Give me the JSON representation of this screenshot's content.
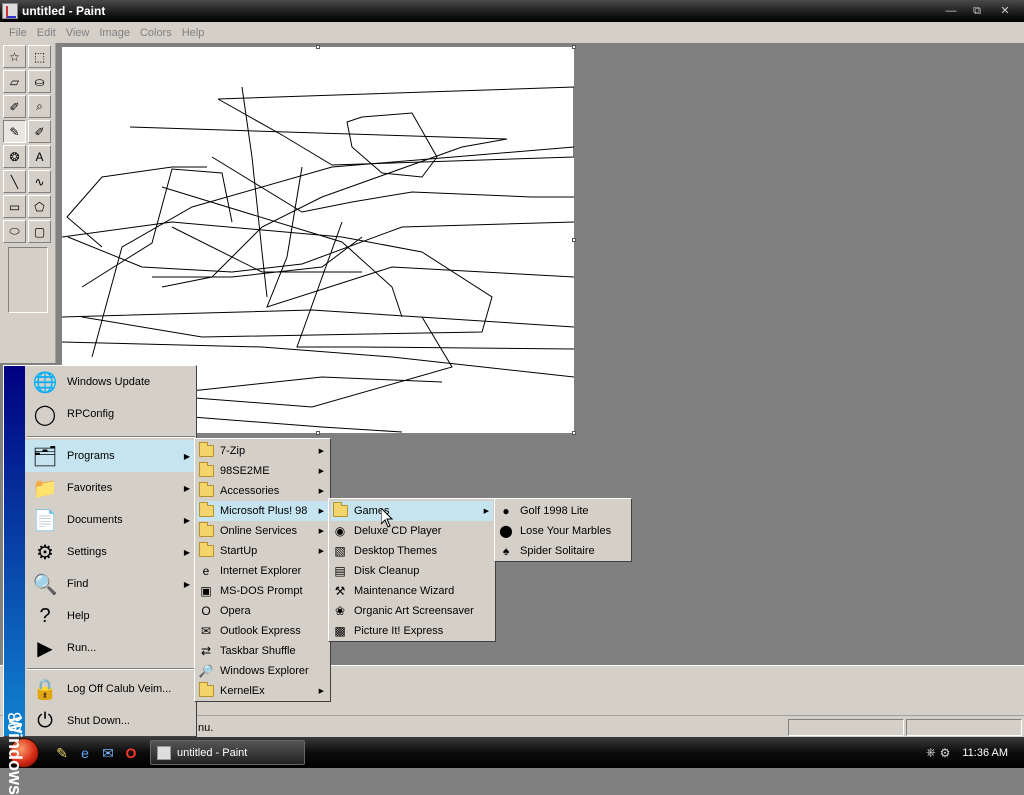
{
  "window": {
    "title": "untitled - Paint",
    "controls": {
      "minimize": "—",
      "maximize": "⧉",
      "close": "✕"
    }
  },
  "menubar": {
    "items": [
      "File",
      "Edit",
      "View",
      "Image",
      "Colors",
      "Help"
    ]
  },
  "toolbox": {
    "tools": [
      {
        "name": "free-form-select-icon",
        "glyph": "☆"
      },
      {
        "name": "rect-select-icon",
        "glyph": "⬚"
      },
      {
        "name": "eraser-icon",
        "glyph": "▱"
      },
      {
        "name": "fill-icon",
        "glyph": "⛀"
      },
      {
        "name": "pick-color-icon",
        "glyph": "✐"
      },
      {
        "name": "magnifier-icon",
        "glyph": "⌕"
      },
      {
        "name": "pencil-icon",
        "glyph": "✎",
        "pressed": true
      },
      {
        "name": "brush-icon",
        "glyph": "✐"
      },
      {
        "name": "airbrush-icon",
        "glyph": "❂"
      },
      {
        "name": "text-icon",
        "glyph": "A"
      },
      {
        "name": "line-icon",
        "glyph": "╲"
      },
      {
        "name": "curve-icon",
        "glyph": "∿"
      },
      {
        "name": "rectangle-icon",
        "glyph": "▭"
      },
      {
        "name": "polygon-icon",
        "glyph": "⬠"
      },
      {
        "name": "ellipse-icon",
        "glyph": "⬭"
      },
      {
        "name": "rounded-rect-icon",
        "glyph": "▢"
      }
    ]
  },
  "statusbar": {
    "text": "nu."
  },
  "taskbar": {
    "task_paint": "untitled - Paint",
    "clock": "11:36 AM"
  },
  "start_menu": {
    "banner_bold": "Windows",
    "banner_regular": "98",
    "items": [
      {
        "label": "Windows Update",
        "icon": "windows-update-icon",
        "glyph": "🌐"
      },
      {
        "label": "RPConfig",
        "icon": "rpconfig-icon",
        "glyph": "◯"
      },
      {
        "label": "Programs",
        "icon": "programs-icon",
        "glyph": "🗂",
        "arrow": true,
        "highlighted": true
      },
      {
        "label": "Favorites",
        "icon": "favorites-icon",
        "glyph": "📁",
        "arrow": true
      },
      {
        "label": "Documents",
        "icon": "documents-icon",
        "glyph": "📄",
        "arrow": true
      },
      {
        "label": "Settings",
        "icon": "settings-icon",
        "glyph": "⚙",
        "arrow": true
      },
      {
        "label": "Find",
        "icon": "find-icon",
        "glyph": "🔍",
        "arrow": true
      },
      {
        "label": "Help",
        "icon": "help-icon",
        "glyph": "?"
      },
      {
        "label": "Run...",
        "icon": "run-icon",
        "glyph": "▶"
      },
      {
        "label": "Log Off Calub Veim...",
        "icon": "log-off-icon",
        "glyph": "🔒"
      },
      {
        "label": "Shut Down...",
        "icon": "shut-down-icon",
        "glyph": "⏻"
      }
    ]
  },
  "programs_menu": {
    "items": [
      {
        "label": "7-Zip",
        "folder": true,
        "arrow": true
      },
      {
        "label": "98SE2ME",
        "folder": true,
        "arrow": true
      },
      {
        "label": "Accessories",
        "folder": true,
        "arrow": true
      },
      {
        "label": "Microsoft Plus! 98",
        "folder": true,
        "arrow": true,
        "highlighted": true
      },
      {
        "label": "Online Services",
        "folder": true,
        "arrow": true
      },
      {
        "label": "StartUp",
        "folder": true,
        "arrow": true
      },
      {
        "label": "Internet Explorer",
        "icon": "internet-explorer-icon",
        "glyph": "e"
      },
      {
        "label": "MS-DOS Prompt",
        "icon": "ms-dos-icon",
        "glyph": "▣"
      },
      {
        "label": "Opera",
        "icon": "opera-icon",
        "glyph": "O"
      },
      {
        "label": "Outlook Express",
        "icon": "outlook-express-icon",
        "glyph": "✉"
      },
      {
        "label": "Taskbar Shuffle",
        "icon": "taskbar-shuffle-icon",
        "glyph": "⇄"
      },
      {
        "label": "Windows Explorer",
        "icon": "windows-explorer-icon",
        "glyph": "🔎"
      },
      {
        "label": "KernelEx",
        "folder": true,
        "arrow": true
      }
    ]
  },
  "plus_menu": {
    "items": [
      {
        "label": "Games",
        "folder": true,
        "arrow": true,
        "highlighted": true
      },
      {
        "label": "Deluxe CD Player",
        "icon": "cd-player-icon",
        "glyph": "◉"
      },
      {
        "label": "Desktop Themes",
        "icon": "desktop-themes-icon",
        "glyph": "▧"
      },
      {
        "label": "Disk Cleanup",
        "icon": "disk-cleanup-icon",
        "glyph": "▤"
      },
      {
        "label": "Maintenance Wizard",
        "icon": "maintenance-wizard-icon",
        "glyph": "⚒"
      },
      {
        "label": "Organic Art Screensaver",
        "icon": "organic-art-icon",
        "glyph": "❀"
      },
      {
        "label": "Picture It! Express",
        "icon": "picture-it-icon",
        "glyph": "▩"
      }
    ]
  },
  "games_menu": {
    "items": [
      {
        "label": "Golf 1998 Lite",
        "icon": "golf-icon",
        "glyph": "●"
      },
      {
        "label": "Lose Your Marbles",
        "icon": "marbles-icon",
        "glyph": "⬤"
      },
      {
        "label": "Spider Solitaire",
        "icon": "spider-solitaire-icon",
        "glyph": "♠"
      }
    ]
  },
  "colors": {
    "menu_highlight": "#c6e4f0",
    "face": "#d4d0c8",
    "banner_top": "#000080",
    "banner_bottom": "#1084d0",
    "workspace": "#808080"
  }
}
